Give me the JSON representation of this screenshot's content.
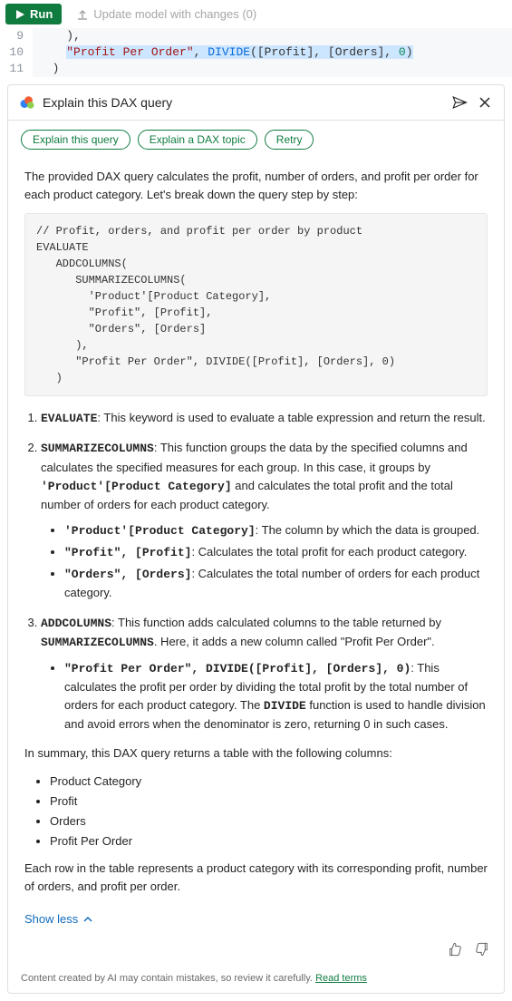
{
  "toolbar": {
    "run_label": "Run",
    "update_label": "Update model with changes (0)"
  },
  "code": {
    "line_numbers": [
      "9",
      "10",
      "11"
    ],
    "line9": "    ),",
    "line10_col": "\"Profit Per Order\"",
    "line10_sep": ", ",
    "line10_func": "DIVIDE",
    "line10_rest": "([Profit], [Orders], ",
    "line10_num": "0",
    "line10_close": ")",
    "line11": "  )"
  },
  "panel": {
    "title": "Explain this DAX query",
    "tabs": [
      "Explain this query",
      "Explain a DAX topic",
      "Retry"
    ],
    "intro": "The provided DAX query calculates the profit, number of orders, and profit per order for each product category. Let's break down the query step by step:",
    "code_block": "// Profit, orders, and profit per order by product\nEVALUATE\n   ADDCOLUMNS(\n      SUMMARIZECOLUMNS(\n        'Product'[Product Category],\n        \"Profit\", [Profit],\n        \"Orders\", [Orders]\n      ),\n      \"Profit Per Order\", DIVIDE([Profit], [Orders], 0)\n   )",
    "item1_kw": "EVALUATE",
    "item1_rest": ": This keyword is used to evaluate a table expression and return the result.",
    "item2_kw": "SUMMARIZECOLUMNS",
    "item2_rest_a": ": This function groups the data by the specified columns and calculates the specified measures for each group. In this case, it groups by ",
    "item2_code": "'Product'[Product Category]",
    "item2_rest_b": " and calculates the total profit and the total number of orders for each product category.",
    "item2_sub1_code": "'Product'[Product Category]",
    "item2_sub1_text": ": The column by which the data is grouped.",
    "item2_sub2_code": "\"Profit\", [Profit]",
    "item2_sub2_text": ": Calculates the total profit for each product category.",
    "item2_sub3_code": "\"Orders\", [Orders]",
    "item2_sub3_text": ": Calculates the total number of orders for each product category.",
    "item3_kw": "ADDCOLUMNS",
    "item3_rest_a": ": This function adds calculated columns to the table returned by ",
    "item3_kw2": "SUMMARIZECOLUMNS",
    "item3_rest_b": ". Here, it adds a new column called \"Profit Per Order\".",
    "item3_sub_code": "\"Profit Per Order\", DIVIDE([Profit], [Orders], 0)",
    "item3_sub_text_a": ": This calculates the profit per order by dividing the total profit by the total number of orders for each product category. The ",
    "item3_sub_kw": "DIVIDE",
    "item3_sub_text_b": " function is used to handle division and avoid errors when the denominator is zero, returning 0 in such cases.",
    "summary_intro": "In summary, this DAX query returns a table with the following columns:",
    "summary_items": [
      "Product Category",
      "Profit",
      "Orders",
      "Profit Per Order"
    ],
    "closing": "Each row in the table represents a product category with its corresponding profit, number of orders, and profit per order.",
    "show_less": "Show less",
    "footer_text": "Content created by AI may contain mistakes, so review it carefully. ",
    "footer_link": "Read terms"
  }
}
